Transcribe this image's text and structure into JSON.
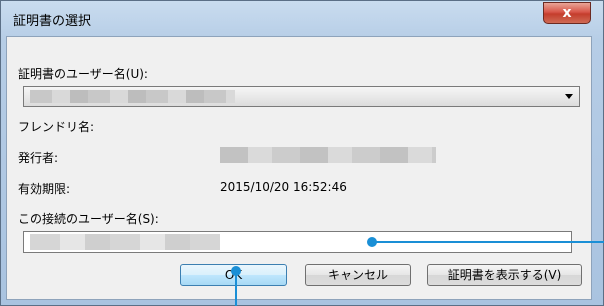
{
  "window": {
    "title": "証明書の選択",
    "close_glyph": "x"
  },
  "fields": {
    "cert_user_label": "証明書のユーザー名(U):",
    "friendly_name_label": "フレンドリ名:",
    "issuer_label": "発行者:",
    "expiry_label": "有効期限:",
    "expiry_value": "2015/10/20 16:52:46",
    "conn_user_label": "この接続のユーザー名(S):"
  },
  "buttons": {
    "ok": "OK",
    "cancel": "キャンセル",
    "view_cert": "証明書を表示する(V)"
  },
  "colors": {
    "callout": "#1a8fd6",
    "close_button": "#c43d2c"
  }
}
